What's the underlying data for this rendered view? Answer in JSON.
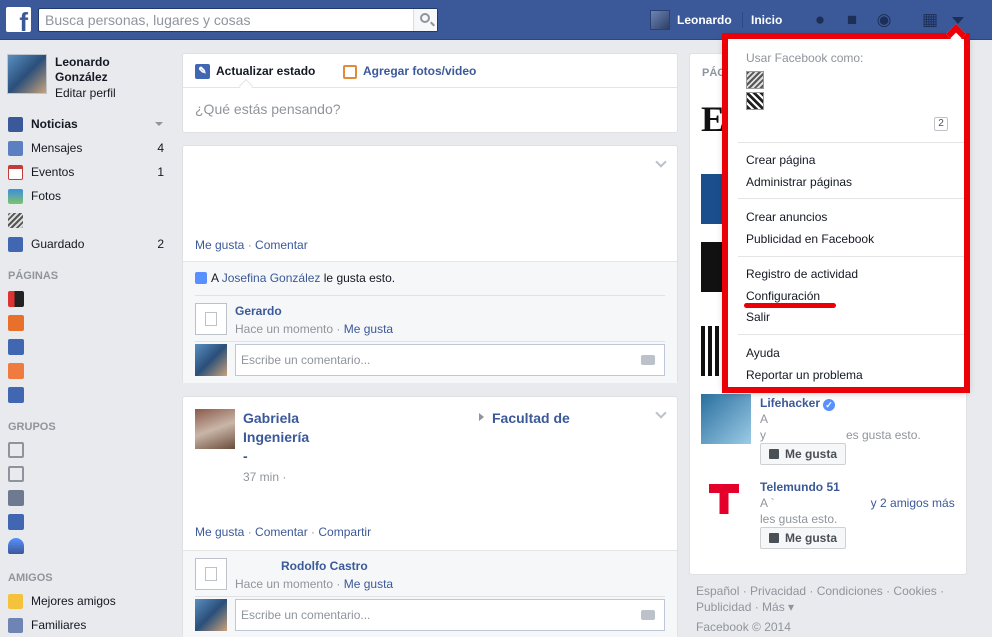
{
  "topbar": {
    "logo": "f",
    "search_placeholder": "Busca personas, lugares y cosas",
    "user_name": "Leonardo",
    "home_label": "Inicio",
    "icons": [
      "friend-requests-icon",
      "messages-icon",
      "notifications-globe-icon",
      "privacy-lock-icon",
      "account-caret-icon"
    ]
  },
  "left": {
    "profile_name": "Leonardo González",
    "edit_profile": "Editar perfil",
    "nav": [
      {
        "label": "Noticias",
        "count": "",
        "color": "#3b5998"
      },
      {
        "label": "Mensajes",
        "count": "4",
        "color": "#5c7fc1"
      },
      {
        "label": "Eventos",
        "count": "1",
        "color": "#c43b3b"
      },
      {
        "label": "Fotos",
        "count": "",
        "color": "#3b8ee0"
      },
      {
        "label": "",
        "count": "",
        "color": "#666666"
      },
      {
        "label": "Guardado",
        "count": "2",
        "color": "#4267b2"
      }
    ],
    "sections": {
      "pages": "PÁGINAS",
      "groups": "GRUPOS",
      "friends": "AMIGOS"
    },
    "friends": [
      {
        "label": "Mejores amigos"
      },
      {
        "label": "Familiares"
      }
    ]
  },
  "composer": {
    "tab_status": "Actualizar estado",
    "tab_photos": "Agregar fotos/video",
    "placeholder": "¿Qué estás pensando?"
  },
  "post1": {
    "like": "Me gusta",
    "comment": "Comentar",
    "likes_prefix": "A",
    "likes_name": "Josefina González",
    "likes_suffix": "le gusta esto.",
    "comment_author": "Gerardo",
    "comment_time": "Hace un momento",
    "comment_like": "Me gusta",
    "reply_placeholder": "Escribe un comentario..."
  },
  "post2": {
    "author": "Gabriela Ingeniería -",
    "group": "Facultad de",
    "time": "37 min ·",
    "like": "Me gusta",
    "comment": "Comentar",
    "share": "Compartir",
    "comment_author": "Rodolfo Castro",
    "comment_time": "Hace un momento",
    "comment_like": "Me gusta",
    "reply_placeholder": "Escribe un comentario..."
  },
  "rightcol": {
    "header": "PÁG",
    "pages": [
      {
        "title": "Lifehacker",
        "line1": "A",
        "line2": "y",
        "line2_tail": "es gusta esto.",
        "button": "Me gusta"
      },
      {
        "title": "Telemundo 51",
        "line1": "A `",
        "line1_tail": "y 2 amigos más",
        "line2": "les gusta esto.",
        "button": "Me gusta"
      }
    ]
  },
  "footer": {
    "links": "Español · Privacidad · Condiciones · Cookies ·",
    "links2": "Publicidad · Más ▾",
    "copyright": "Facebook © 2014"
  },
  "dropdown": {
    "header": "Usar Facebook como:",
    "badge": "2",
    "items": {
      "create_page": "Crear página",
      "manage_pages": "Administrar páginas",
      "create_ads": "Crear anuncios",
      "advertise": "Publicidad en Facebook",
      "activity_log": "Registro de actividad",
      "settings": "Configuración",
      "logout": "Salir",
      "help": "Ayuda",
      "report": "Reportar un problema"
    },
    "highlight_color": "#ec0007"
  }
}
